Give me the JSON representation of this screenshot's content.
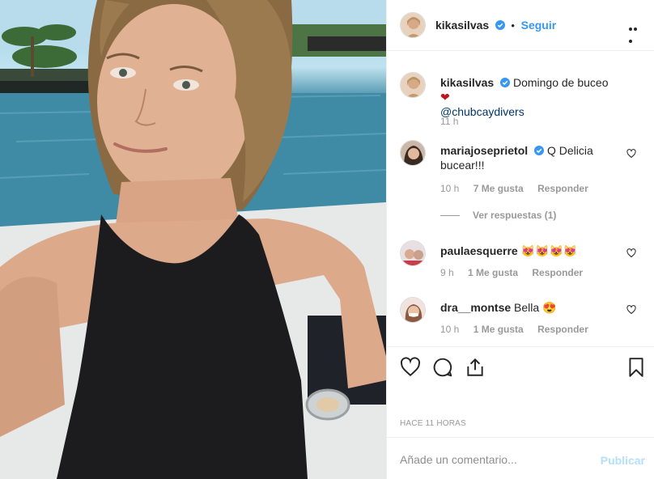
{
  "post": {
    "author": "kikasilvas",
    "follow_label": "Seguir",
    "dot": "•",
    "caption_text": "Domingo de buceo",
    "caption_emoji": "❤",
    "caption_mention": "@chubcaydivers",
    "caption_time": "11 h",
    "posted_time": "HACE 11 HORAS"
  },
  "comments": [
    {
      "user": "mariajoseprietol",
      "verified": true,
      "text": "Q Delicia bucear!!!",
      "time": "10 h",
      "likes": "7 Me gusta",
      "reply": "Responder"
    },
    {
      "user": "paulaesquerre",
      "verified": false,
      "text": "😻😻😻😻",
      "time": "9 h",
      "likes": "1 Me gusta",
      "reply": "Responder"
    },
    {
      "user": "dra__montse",
      "verified": false,
      "text": "Bella 😍",
      "time": "10 h",
      "likes": "1 Me gusta",
      "reply": "Responder"
    }
  ],
  "view_replies": "Ver respuestas (1)",
  "add_comment": {
    "placeholder": "Añade un comentario...",
    "publish": "Publicar"
  },
  "icons": {
    "more": "more-options-icon",
    "verified": "verified-badge-icon",
    "like": "heart-icon",
    "comment": "comment-icon",
    "share": "share-icon",
    "save": "bookmark-icon"
  },
  "colors": {
    "link": "#3897f0",
    "publish_disabled": "#b2dffc",
    "heart": "#ed4956",
    "verified": "#3897f0"
  }
}
